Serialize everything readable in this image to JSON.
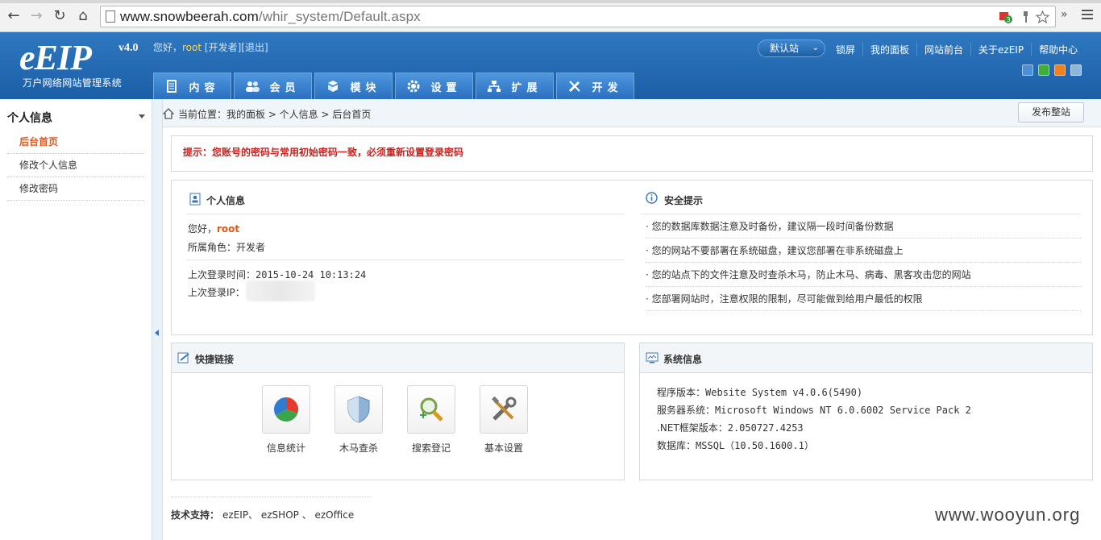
{
  "browser": {
    "url_host": "www.snowbeerah.com",
    "url_path": "/whir_system/Default.aspx",
    "ext_badge": "3",
    "overflow": "»"
  },
  "header": {
    "logo_text": "EIP",
    "logo_version": "v4.0",
    "logo_subtitle": "万户网络网站管理系统",
    "greeting_prefix": "您好，",
    "greeting_user": "root",
    "greeting_role": "[开发者]",
    "logout_label": "[退出]",
    "site_select": "默认站",
    "top_links": [
      "锁屏",
      "我的面板",
      "网站前台",
      "关于ezEIP",
      "帮助中心"
    ],
    "nav": [
      {
        "label": "内容",
        "icon": "document-icon"
      },
      {
        "label": "会员",
        "icon": "users-icon"
      },
      {
        "label": "模块",
        "icon": "cubes-icon"
      },
      {
        "label": "设置",
        "icon": "gear-icon"
      },
      {
        "label": "扩展",
        "icon": "sitemap-icon"
      },
      {
        "label": "开发",
        "icon": "tools-icon"
      }
    ],
    "skins": [
      "#4d8fd4",
      "#3fae3b",
      "#f07f1d",
      "#8db6dc"
    ]
  },
  "sidebar": {
    "title": "个人信息",
    "items": [
      "后台首页",
      "修改个人信息",
      "修改密码"
    ]
  },
  "crumb": {
    "text": "当前位置：我的面板 > 个人信息 > 后台首页",
    "publish_label": "发布整站"
  },
  "notice": "提示：您账号的密码与常用初始密码一致，必须重新设置登录密码",
  "personal": {
    "title": "个人信息",
    "hello": "您好，",
    "user": "root",
    "role": "所属角色：开发者",
    "last_login_time_label": "上次登录时间：",
    "last_login_time": "2015-10-24 10:13:24",
    "last_login_ip_label": "上次登录IP："
  },
  "security": {
    "title": "安全提示",
    "tips": [
      "· 您的数据库数据注意及时备份，建议隔一段时间备份数据",
      "· 您的网站不要部署在系统磁盘，建议您部署在非系统磁盘上",
      "· 您的站点下的文件注意及时查杀木马，防止木马、病毒、黑客攻击您的网站",
      "· 您部署网站时，注意权限的限制，尽可能做到给用户最低的权限"
    ]
  },
  "quick": {
    "title": "快捷链接",
    "items": [
      {
        "label": "信息统计",
        "icon": "pie-chart-icon"
      },
      {
        "label": "木马查杀",
        "icon": "shield-icon"
      },
      {
        "label": "搜索登记",
        "icon": "magnifier-icon"
      },
      {
        "label": "基本设置",
        "icon": "tools-icon"
      }
    ]
  },
  "system": {
    "title": "系统信息",
    "rows": [
      {
        "k": "程序版本：",
        "v": "Website System v4.0.6(5490)"
      },
      {
        "k": "服务器系统：",
        "v": "Microsoft Windows NT 6.0.6002 Service Pack 2"
      },
      {
        "k": ".NET框架版本：",
        "v": "2.050727.4253"
      },
      {
        "k": "数据库：",
        "v": "MSSQL（10.50.1600.1）"
      }
    ]
  },
  "support": {
    "label": "技术支持：",
    "links": "ezEIP、 ezSHOP 、 ezOffice"
  },
  "watermark": "www.wooyun.org"
}
